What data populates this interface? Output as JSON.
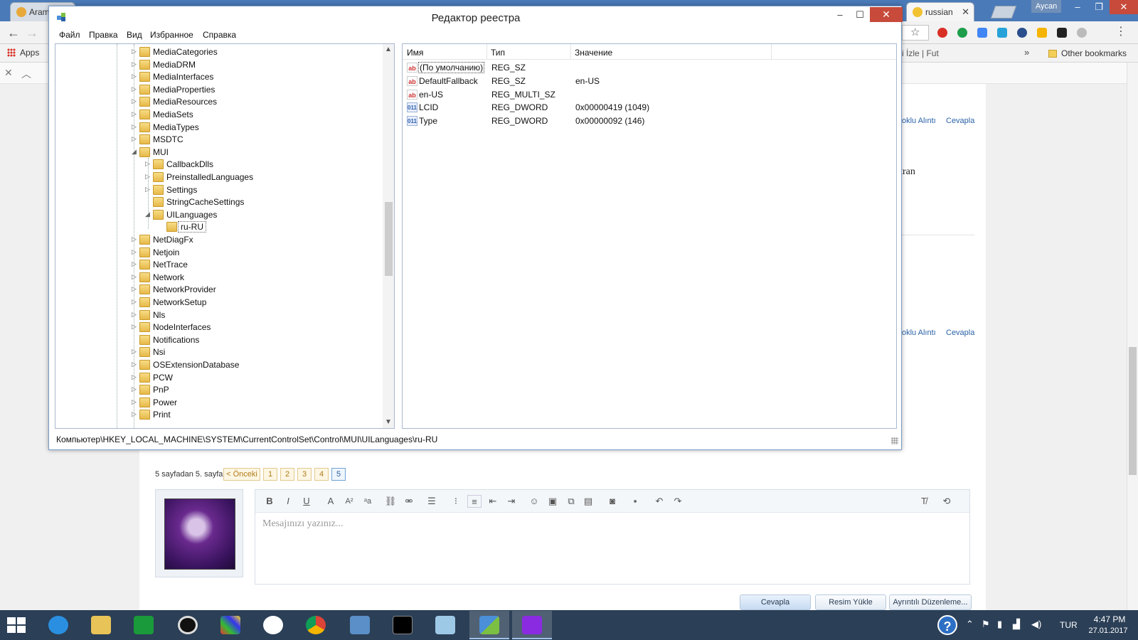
{
  "browser": {
    "tabs": [
      {
        "title": "Aram",
        "active": false
      },
      {
        "title": "russian",
        "active": true
      }
    ],
    "profile": "Aycan",
    "bookmarks": {
      "apps": "Apps",
      "fragment": "i İzle | Fut",
      "overflow": "»",
      "other": "Other bookmarks"
    }
  },
  "page": {
    "links": {
      "multi_quote_1": "oklu Alıntı",
      "reply_1": "Cevapla",
      "multi_quote_2": "oklu Alıntı",
      "reply_2": "Cevapla"
    },
    "text_fragment": "kran",
    "pager": {
      "label": "5 sayfadan 5. sayfa",
      "prev": "< Önceki",
      "pages": [
        "1",
        "2",
        "3",
        "4",
        "5"
      ],
      "current": "5"
    },
    "editor": {
      "placeholder": "Mesajınızı yazınız..."
    },
    "buttons": {
      "reply": "Cevapla",
      "upload_image": "Resim Yükle",
      "advanced_edit": "Ayrıntılı Düzenleme..."
    }
  },
  "regedit": {
    "title": "Редактор реестра",
    "menu": [
      "Файл",
      "Правка",
      "Вид",
      "Избранное",
      "Справка"
    ],
    "tree": [
      {
        "label": "MediaCategories",
        "level": 0,
        "toggle": "▷"
      },
      {
        "label": "MediaDRM",
        "level": 0,
        "toggle": "▷"
      },
      {
        "label": "MediaInterfaces",
        "level": 0,
        "toggle": "▷"
      },
      {
        "label": "MediaProperties",
        "level": 0,
        "toggle": "▷"
      },
      {
        "label": "MediaResources",
        "level": 0,
        "toggle": "▷"
      },
      {
        "label": "MediaSets",
        "level": 0,
        "toggle": "▷"
      },
      {
        "label": "MediaTypes",
        "level": 0,
        "toggle": "▷"
      },
      {
        "label": "MSDTC",
        "level": 0,
        "toggle": "▷"
      },
      {
        "label": "MUI",
        "level": 0,
        "toggle": "◢"
      },
      {
        "label": "CallbackDlls",
        "level": 1,
        "toggle": "▷"
      },
      {
        "label": "PreinstalledLanguages",
        "level": 1,
        "toggle": "▷"
      },
      {
        "label": "Settings",
        "level": 1,
        "toggle": "▷"
      },
      {
        "label": "StringCacheSettings",
        "level": 1,
        "toggle": ""
      },
      {
        "label": "UILanguages",
        "level": 1,
        "toggle": "◢"
      },
      {
        "label": "ru-RU",
        "level": 2,
        "toggle": "",
        "selected": true
      },
      {
        "label": "NetDiagFx",
        "level": 0,
        "toggle": "▷"
      },
      {
        "label": "Netjoin",
        "level": 0,
        "toggle": "▷"
      },
      {
        "label": "NetTrace",
        "level": 0,
        "toggle": "▷"
      },
      {
        "label": "Network",
        "level": 0,
        "toggle": "▷"
      },
      {
        "label": "NetworkProvider",
        "level": 0,
        "toggle": "▷"
      },
      {
        "label": "NetworkSetup",
        "level": 0,
        "toggle": "▷"
      },
      {
        "label": "Nls",
        "level": 0,
        "toggle": "▷"
      },
      {
        "label": "NodeInterfaces",
        "level": 0,
        "toggle": "▷"
      },
      {
        "label": "Notifications",
        "level": 0,
        "toggle": ""
      },
      {
        "label": "Nsi",
        "level": 0,
        "toggle": "▷"
      },
      {
        "label": "OSExtensionDatabase",
        "level": 0,
        "toggle": "▷"
      },
      {
        "label": "PCW",
        "level": 0,
        "toggle": "▷"
      },
      {
        "label": "PnP",
        "level": 0,
        "toggle": "▷"
      },
      {
        "label": "Power",
        "level": 0,
        "toggle": "▷"
      },
      {
        "label": "Print",
        "level": 0,
        "toggle": "▷"
      }
    ],
    "columns": {
      "name": "Имя",
      "type": "Тип",
      "value": "Значение"
    },
    "values": [
      {
        "name": "(По умолчанию)",
        "type": "REG_SZ",
        "value": "",
        "icon": "ab",
        "focus": true
      },
      {
        "name": "DefaultFallback",
        "type": "REG_SZ",
        "value": "en-US",
        "icon": "ab"
      },
      {
        "name": "en-US",
        "type": "REG_MULTI_SZ",
        "value": "",
        "icon": "ab"
      },
      {
        "name": "LCID",
        "type": "REG_DWORD",
        "value": "0x00000419 (1049)",
        "icon": "011"
      },
      {
        "name": "Type",
        "type": "REG_DWORD",
        "value": "0x00000092 (146)",
        "icon": "011"
      }
    ],
    "status_path": "Компьютер\\HKEY_LOCAL_MACHINE\\SYSTEM\\CurrentControlSet\\Control\\MUI\\UILanguages\\ru-RU"
  },
  "taskbar": {
    "language": "TUR",
    "time": "4:47 PM",
    "date": "27.01.2017"
  }
}
